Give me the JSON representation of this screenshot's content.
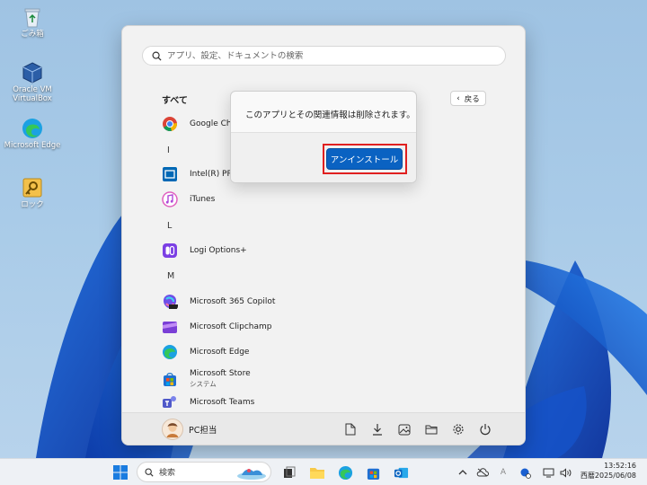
{
  "desktop": {
    "icons": [
      {
        "label": "ごみ箱",
        "icon": "recycle-bin-icon"
      },
      {
        "label": "Oracle VM VirtualBox",
        "icon": "virtualbox-icon"
      },
      {
        "label": "Microsoft Edge",
        "icon": "edge-icon"
      },
      {
        "label": "ロック",
        "icon": "lock-key-icon"
      }
    ]
  },
  "start_menu": {
    "search_placeholder": "アプリ、設定、ドキュメントの検索",
    "all_label": "すべて",
    "back_label": "戻る",
    "letters": {
      "i": "I",
      "l": "L",
      "m": "M"
    },
    "apps": [
      {
        "name": "Google Chrome",
        "shown": "Google Chro",
        "icon": "chrome-icon"
      },
      {
        "name": "Intel(R) PROSet",
        "shown": "Intel(R) PRO",
        "icon": "intel-icon"
      },
      {
        "name": "iTunes",
        "icon": "itunes-icon"
      },
      {
        "name": "Logi Options+",
        "icon": "logi-icon"
      },
      {
        "name": "Microsoft 365 Copilot",
        "icon": "copilot-icon"
      },
      {
        "name": "Microsoft Clipchamp",
        "icon": "clipchamp-icon"
      },
      {
        "name": "Microsoft Edge",
        "icon": "edge-icon"
      },
      {
        "name": "Microsoft Store",
        "sub": "システム",
        "icon": "store-icon"
      },
      {
        "name": "Microsoft Teams",
        "icon": "teams-icon"
      }
    ],
    "user_name": "PC担当"
  },
  "dialog": {
    "message": "このアプリとその関連情報は削除されます。",
    "button": "アンインストール"
  },
  "taskbar": {
    "search_label": "検索",
    "time": "13:52:16",
    "date": "西暦2025/06/08",
    "ime": "A"
  },
  "colors": {
    "accent": "#0a62c2",
    "highlight": "#e02020"
  }
}
